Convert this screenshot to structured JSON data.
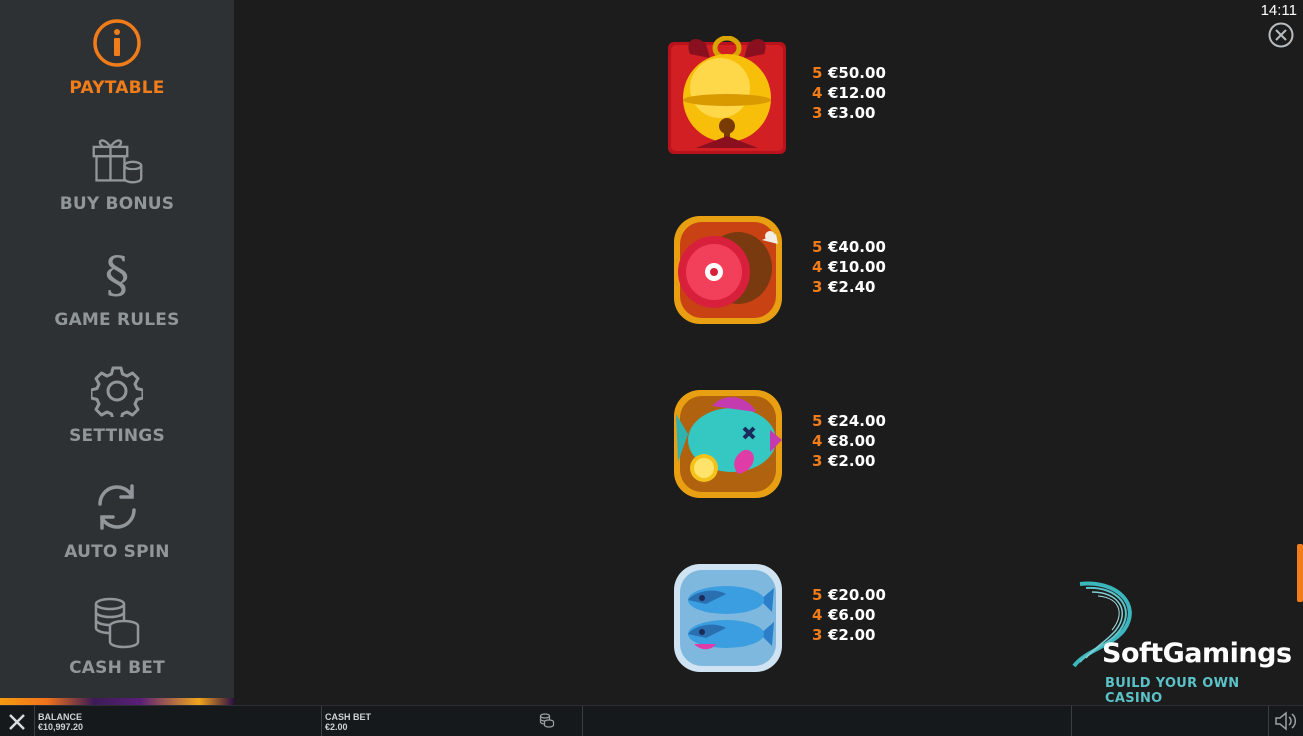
{
  "sidebar": {
    "items": [
      {
        "label": "PAYTABLE",
        "icon": "info-icon",
        "active": true
      },
      {
        "label": "BUY BONUS",
        "icon": "gift-coins-icon",
        "active": false
      },
      {
        "label": "GAME RULES",
        "icon": "section-sign-icon",
        "active": false
      },
      {
        "label": "SETTINGS",
        "icon": "gear-icon",
        "active": false
      },
      {
        "label": "AUTO SPIN",
        "icon": "refresh-icon",
        "active": false
      },
      {
        "label": "CASH BET",
        "icon": "coin-stack-icon",
        "active": false
      }
    ]
  },
  "status": {
    "time": "14:11",
    "close_icon": "close-circle-icon"
  },
  "paytable": {
    "rows": [
      {
        "symbol": "bell-icon",
        "pays": [
          {
            "count": "5",
            "amount": "€50.00"
          },
          {
            "count": "4",
            "amount": "€12.00"
          },
          {
            "count": "3",
            "amount": "€3.00"
          }
        ]
      },
      {
        "symbol": "ham-icon",
        "pays": [
          {
            "count": "5",
            "amount": "€40.00"
          },
          {
            "count": "4",
            "amount": "€10.00"
          },
          {
            "count": "3",
            "amount": "€2.40"
          }
        ]
      },
      {
        "symbol": "fish-icon",
        "pays": [
          {
            "count": "5",
            "amount": "€24.00"
          },
          {
            "count": "4",
            "amount": "€8.00"
          },
          {
            "count": "3",
            "amount": "€2.00"
          }
        ]
      },
      {
        "symbol": "two-fish-icon",
        "pays": [
          {
            "count": "5",
            "amount": "€20.00"
          },
          {
            "count": "4",
            "amount": "€6.00"
          },
          {
            "count": "3",
            "amount": "€2.00"
          }
        ]
      }
    ]
  },
  "watermark": {
    "name": "SoftGamings",
    "tagline": "BUILD YOUR OWN CASINO"
  },
  "bottombar": {
    "balance_label": "BALANCE",
    "balance_value": "€10,997.20",
    "cashbet_label": "CASH BET",
    "cashbet_value": "€2.00"
  },
  "colors": {
    "accent": "#f07c1a",
    "sidebar": "#2e3134",
    "background": "#1c1c1c",
    "muted": "#909699"
  }
}
